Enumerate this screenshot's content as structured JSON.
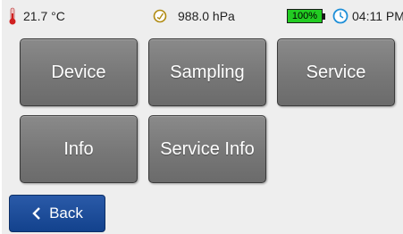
{
  "status": {
    "temperature": "21.7 °C",
    "pressure": "988.0 hPa",
    "battery_percent": "100%",
    "time": "04:11 PM",
    "battery_level": 1.0,
    "icons": [
      "thermometer-icon",
      "gauge-icon",
      "battery-icon",
      "clock-icon"
    ]
  },
  "menu": {
    "device": "Device",
    "sampling": "Sampling",
    "service": "Service",
    "info": "Info",
    "service_info": "Service Info"
  },
  "nav": {
    "back": "Back"
  },
  "colors": {
    "tile": "#777777",
    "back_button": "#1b4a96",
    "battery": "#22cc22",
    "clock": "#1e8fd8",
    "thermometer": "#d02020"
  }
}
